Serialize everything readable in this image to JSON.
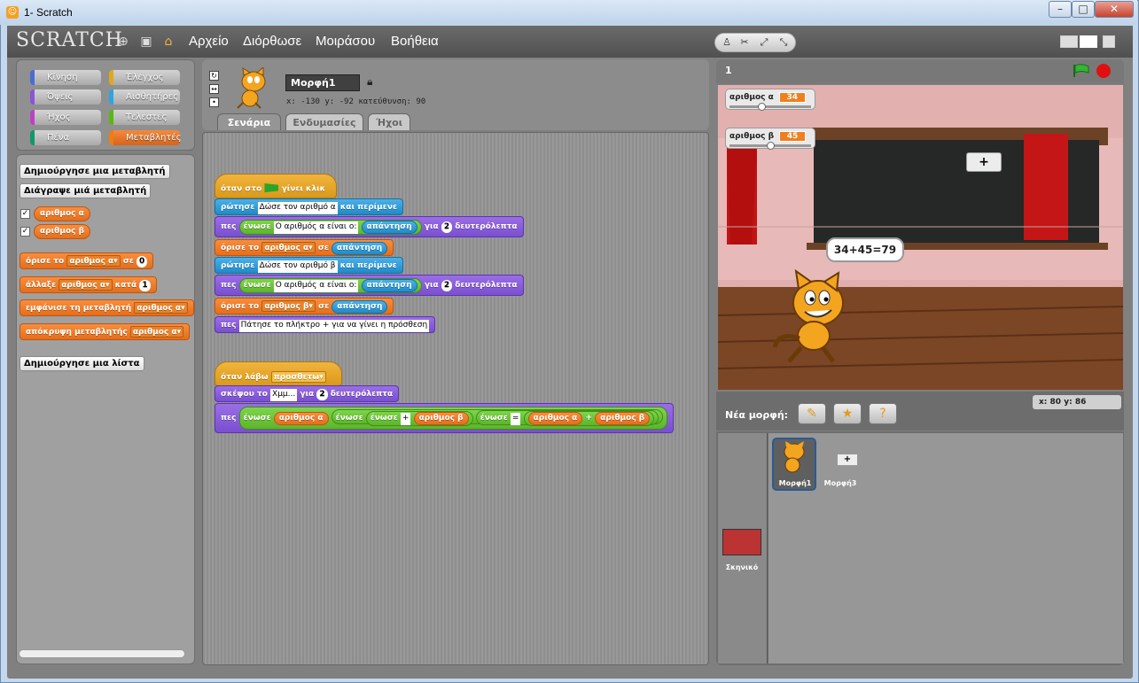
{
  "window": {
    "title": "1- Scratch",
    "min": "–",
    "max": "□",
    "close": "✕"
  },
  "menu": {
    "logo": "SCRATCH",
    "items": [
      "Αρχείο",
      "Διόρθωσε",
      "Μοιράσου",
      "Βοήθεια"
    ]
  },
  "categories": [
    {
      "label": "Κίνηση",
      "color": "#4a6cd4"
    },
    {
      "label": "Έλεγχος",
      "color": "#e1a91a"
    },
    {
      "label": "Όψεις",
      "color": "#8a55d7"
    },
    {
      "label": "Αισθητήρες",
      "color": "#2ca5e2"
    },
    {
      "label": "Ήχος",
      "color": "#bb42c3"
    },
    {
      "label": "Τελεστές",
      "color": "#5cb712"
    },
    {
      "label": "Πένα",
      "color": "#0e9a6c"
    },
    {
      "label": "Μεταβλητές",
      "color": "#ee7d16"
    }
  ],
  "palette": {
    "create_var": "Δημιούργησε μια μεταβλητή",
    "delete_var": "Διάγραψε μιά μεταβλητή",
    "vars": [
      "αριθμος α",
      "αριθμος β"
    ],
    "check": "✓",
    "set_label": "όρισε το",
    "set_var": "αριθμος α",
    "set_to": "σε",
    "set_value": "0",
    "change_label": "άλλαξε",
    "change_var": "αριθμος α",
    "change_by": "κατά",
    "change_value": "1",
    "show_label": "εμφάνισε τη μεταβλητή",
    "show_var": "αριθμος α",
    "hide_label": "απόκρυψη μεταβλητής",
    "hide_var": "αριθμος α",
    "create_list": "Δημιούργησε μια λίστα"
  },
  "sprite": {
    "name": "Μορφή1",
    "x_label": "x:",
    "x": "-130",
    "y_label": "y:",
    "y": "-92",
    "dir_label": "κατεύθυνση:",
    "dir": "90"
  },
  "tabs": {
    "scripts": "Σενάρια",
    "costumes": "Ενδυμασίες",
    "sounds": "Ήχοι"
  },
  "script1": {
    "hat_pre": "όταν στο",
    "hat_post": "γίνει κλικ",
    "ask1_label": "ρώτησε",
    "ask1_text": "Δώσε τον αριθμό α",
    "ask_wait": "και περίμενε",
    "say_label": "πες",
    "join": "ένωσε",
    "say1_text": "Ο αριθμός α είναι ο:",
    "answer": "απάντηση",
    "for_label": "για",
    "secs": "2",
    "secs_label": "δευτερόλεπτα",
    "set_label": "όρισε το",
    "set1_var": "αριθμος α",
    "set_to": "σε",
    "ask2_text": "Δώσε τον αριθμό β",
    "say2_text": "Ο αριθμός α είναι ο:",
    "set2_var": "αριθμος β",
    "say3_text": "Πάτησε το πλήκτρο + για να γίνει η πρόσθεση"
  },
  "script2": {
    "hat_label": "όταν λάβω",
    "hat_msg": "προσθετω",
    "think_label": "σκέψου το",
    "think_text": "Χμμ...",
    "for_label": "για",
    "secs": "2",
    "secs_label": "δευτερόλεπτα",
    "say_label": "πες",
    "join": "ένωσε",
    "var_a": "αριθμος α",
    "var_b": "αριθμος β",
    "plus": "+",
    "eq": "=",
    "plus_op": "+"
  },
  "stage": {
    "number": "1",
    "watchers": [
      {
        "label": "αριθμος α",
        "value": "34"
      },
      {
        "label": "αριθμος β",
        "value": "45"
      }
    ],
    "speech": "34+45=79",
    "plus_sprite": "+"
  },
  "xy": {
    "x_label": "x:",
    "x": "80",
    "y_label": "y:",
    "y": "86"
  },
  "new_sprite": {
    "label": "Νέα μορφή:"
  },
  "sprites": [
    {
      "name": "Μορφή1"
    },
    {
      "name": "Μορφή3"
    }
  ],
  "stage_thumb": {
    "label": "Σκηνικό"
  }
}
